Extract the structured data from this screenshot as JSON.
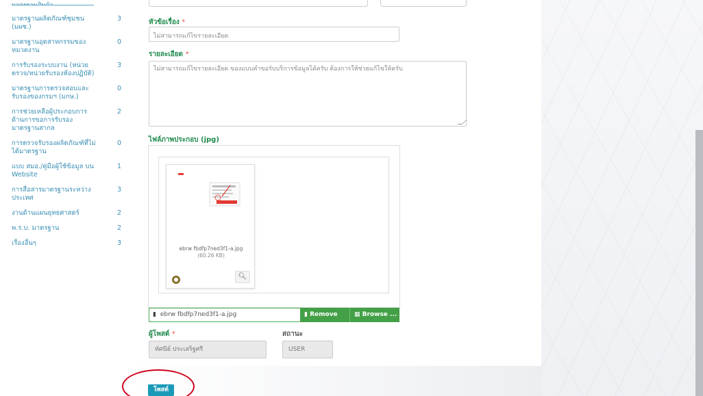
{
  "sidebar": {
    "cut_label": "มาตรฐานสินค้า",
    "items": [
      {
        "label": "มาตรฐานผลิตภัณฑ์ชุมชน (มผช.)",
        "count": "3"
      },
      {
        "label": "มาตรฐานอุตสาหกรรมของหมวดงาน",
        "count": "0"
      },
      {
        "label": "การรับรองระบบงาน (หน่วยตรวจ/หน่วยรับรองห้องปฏิบัติ)",
        "count": "3"
      },
      {
        "label": "มาตรฐานการตรวจสอบและรับรองของกรมฯ (มกษ.)",
        "count": "0"
      },
      {
        "label": "การช่วยเหลือผู้ประกอบการด้านการขอการรับรองมาตรฐานสากล",
        "count": "2"
      },
      {
        "label": "การตรวจรับรองผลิตภัณฑ์ที่ไม่ได้มาตรฐาน",
        "count": "0"
      },
      {
        "label": "แบบ สมอ./คู่มือผู้ใช้ข้อมูล บน Website",
        "count": "1"
      },
      {
        "label": "การสื่อสารมาตรฐานระหว่างประเทศ",
        "count": "3"
      },
      {
        "label": "งานด้านแผนยุทธศาสตร์",
        "count": "2"
      },
      {
        "label": "พ.ร.บ. มาตรฐาน",
        "count": "2"
      },
      {
        "label": "เรื่องอื่นๆ",
        "count": "3"
      }
    ]
  },
  "form": {
    "title_label": "หัวข้อเรื่อง",
    "title_required": "*",
    "title_placeholder": "ไม่สามารถแก้ไขรายละเอียด",
    "detail_label": "รายละเอียด",
    "detail_required": "*",
    "detail_value": "ไม่สามารถแก้ไขรายละเอียด ของแบบคำขอรับบริการข้อมูลได้ครับ ต้องการให้ช่วยแก้ไขให้ครับ",
    "image_label": "ไฟล์ภาพประกอบ (jpg)",
    "thumb_filename": "ebrw fbdfp7ned3f1-a.jpg",
    "thumb_size": "(60.26 KB)",
    "file_caption": "ebrw fbdfp7ned3f1-a.jpg",
    "remove_label": "Remove",
    "browse_label": "Browse ...",
    "owner_label": "ผู้โพสต์",
    "owner_required": "*",
    "owner_value": "ทัศนีย์ ประเสริฐศรี",
    "status_label": "สถานะ",
    "status_value": "USER",
    "save_label": "โพสต์"
  },
  "icons": {
    "file": "file-icon",
    "trash": "trash-icon",
    "folder": "folder-icon",
    "zoom": "zoom-icon",
    "gear": "gear-icon"
  },
  "colors": {
    "label_green": "#1f8a4c",
    "sidebar_blue": "#3a8fb5",
    "button_green": "#43a047",
    "save_blue": "#1b9ab8",
    "annotation_red": "#d0021b"
  }
}
